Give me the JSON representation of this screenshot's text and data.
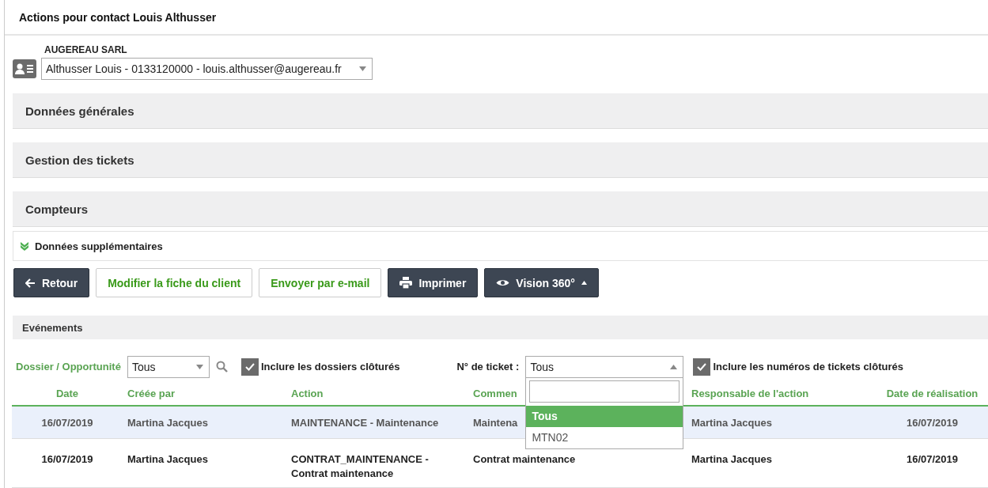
{
  "window": {
    "title": "Actions pour contact Louis Althusser"
  },
  "company": "AUGEREAU SARL",
  "contact_select": {
    "value": "Althusser Louis - 0133120000 - louis.althusser@augereau.fr"
  },
  "sections": [
    {
      "label": "Données générales"
    },
    {
      "label": "Gestion des tickets"
    },
    {
      "label": "Compteurs"
    }
  ],
  "extra_section": {
    "label": "Données supplémentaires"
  },
  "buttons": [
    {
      "label": "Retour",
      "kind": "dark"
    },
    {
      "label": "Modifier la fiche du client",
      "kind": "light"
    },
    {
      "label": "Envoyer par e-mail",
      "kind": "light"
    },
    {
      "label": "Imprimer",
      "kind": "dark"
    },
    {
      "label": "Vision 360°",
      "kind": "dark"
    }
  ],
  "events": {
    "title": "Evénements",
    "dossier_label": "Dossier / Opportunité",
    "dossier_select": {
      "value": "Tous"
    },
    "include_closed_files": {
      "label": "Inclure les dossiers clôturés",
      "checked": true
    },
    "ticket_label": "N° de ticket :",
    "ticket_select": {
      "value": "Tous",
      "expanded": true,
      "options": [
        {
          "label": "Tous",
          "selected": true
        },
        {
          "label": "MTN02",
          "selected": false
        }
      ]
    },
    "include_closed_tickets": {
      "label": "Inclure les numéros de tickets clôturés",
      "checked": true
    },
    "table": {
      "columns": [
        "Date",
        "Créée par",
        "Action",
        "Commen",
        "Responsable de l'action",
        "Date de réalisation"
      ],
      "rows": [
        {
          "cells": [
            "16/07/2019",
            "Martina Jacques",
            "MAINTENANCE - Maintenance",
            "Maintena",
            "Martina Jacques",
            "16/07/2019"
          ],
          "selected": true
        },
        {
          "cells": [
            "16/07/2019",
            "Martina Jacques",
            "CONTRAT_MAINTENANCE - Contrat maintenance",
            "Contrat maintenance",
            "Martina Jacques",
            "16/07/2019"
          ],
          "selected": false
        }
      ]
    }
  }
}
